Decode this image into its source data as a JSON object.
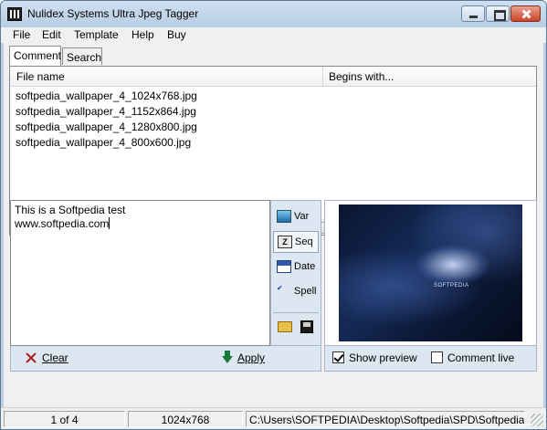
{
  "window": {
    "title": "Nulidex Systems Ultra Jpeg Tagger"
  },
  "menu": {
    "items": [
      "File",
      "Edit",
      "Template",
      "Help",
      "Buy"
    ]
  },
  "tabs": [
    {
      "label": "Comment",
      "active": true
    },
    {
      "label": "Search",
      "active": false
    }
  ],
  "file_list": {
    "columns": [
      "File name",
      "Begins with..."
    ],
    "rows": [
      "softpedia_wallpaper_4_1024x768.jpg",
      "softpedia_wallpaper_4_1152x864.jpg",
      "softpedia_wallpaper_4_1280x800.jpg",
      "softpedia_wallpaper_4_800x600.jpg"
    ]
  },
  "comment": {
    "lines": [
      "This is a Softpedia test",
      "www.softpedia.com"
    ]
  },
  "tools": {
    "var_label": "Var",
    "seq_label": "Seq",
    "date_label": "Date",
    "spell_label": "Spell",
    "seq_icon_text": "Z"
  },
  "actions": {
    "clear_label": "Clear",
    "apply_label": "Apply"
  },
  "preview": {
    "logo_text": "SOFTPEDIA",
    "show_preview_label": "Show preview",
    "show_preview_checked": true,
    "comment_live_label": "Comment live",
    "comment_live_checked": false
  },
  "status": {
    "page": "1 of 4",
    "dimensions": "1024x768",
    "path": "C:\\Users\\SOFTPEDIA\\Desktop\\Softpedia\\SPD\\Softpedia_v"
  },
  "colors": {
    "frame": "#bcd0e4",
    "panel": "#dde7f1",
    "close": "#c9452c"
  },
  "icons": [
    "app-icon",
    "minimize-icon",
    "maximize-icon",
    "close-icon",
    "var-icon",
    "seq-icon",
    "date-icon",
    "spell-icon",
    "open-folder-icon",
    "save-icon",
    "clear-x-icon",
    "apply-arrow-icon"
  ]
}
